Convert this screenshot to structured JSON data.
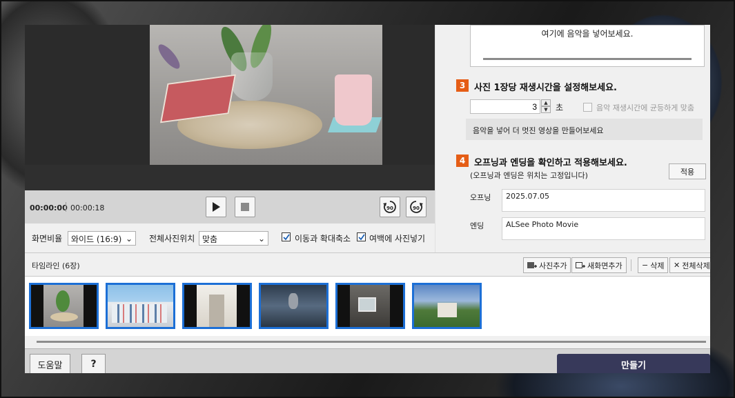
{
  "preview": {
    "time_current": "00:00:00",
    "time_total": "00:00:18"
  },
  "options": {
    "aspect_label": "화면비율",
    "aspect_value": "와이드 (16:9)",
    "position_label": "전체사진위치",
    "position_value": "맞춤",
    "motion_label": "이동과 확대축소",
    "motion_checked": true,
    "fill_label": "여백에 사진넣기",
    "fill_checked": true
  },
  "right_panel": {
    "music_hint": "여기에 음악을 넣어보세요.",
    "step3": {
      "number": "3",
      "title": "사진 1장당 재생시간을 설정해보세요.",
      "duration_value": "3",
      "unit": "초",
      "sync_label": "음악 재생시간에 균등하게 맞춤",
      "info": "음악을 넣어 더 멋진 영상을 만들어보세요"
    },
    "step4": {
      "number": "4",
      "title": "오프닝과 엔딩을 확인하고 적용해보세요.",
      "note": "(오프닝과 엔딩은 위치는 고정입니다)",
      "apply_label": "적용",
      "opening_label": "오프닝",
      "opening_value": "2025.07.05",
      "ending_label": "엔딩",
      "ending_value": "ALSee Photo Movie"
    }
  },
  "timeline": {
    "title": "타임라인 (6장)",
    "add_photo": "사진추가",
    "add_scene": "새화면추가",
    "delete": "삭제",
    "delete_all": "전체삭제",
    "thumbnails": [
      {
        "name": "plant-on-table"
      },
      {
        "name": "colorful-buildings"
      },
      {
        "name": "white-hallway"
      },
      {
        "name": "heron-in-water"
      },
      {
        "name": "stone-window"
      },
      {
        "name": "house-on-hill"
      }
    ]
  },
  "footer": {
    "help": "도움말",
    "question": "?",
    "make": "만들기"
  },
  "colors": {
    "accent_orange": "#e55d16",
    "selection_blue": "#1c6fd6",
    "make_button": "#37395a"
  }
}
